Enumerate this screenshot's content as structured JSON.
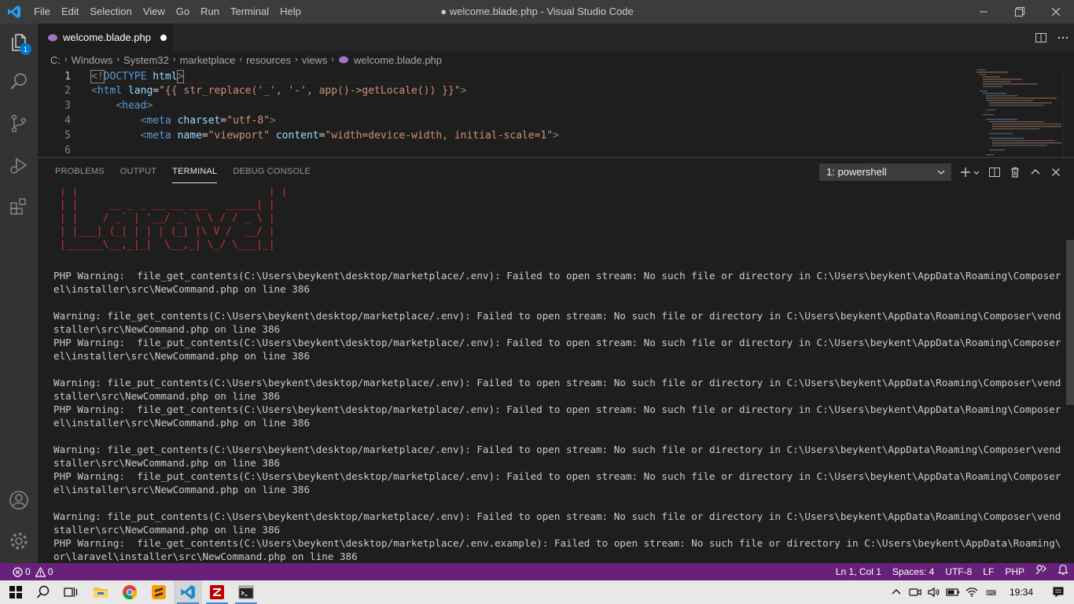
{
  "window": {
    "title": "● welcome.blade.php - Visual Studio Code",
    "menu": [
      "File",
      "Edit",
      "Selection",
      "View",
      "Go",
      "Run",
      "Terminal",
      "Help"
    ]
  },
  "activity_bar": {
    "explorer_badge": "1"
  },
  "editor": {
    "tab_label": "welcome.blade.php",
    "breadcrumb": [
      "C:",
      "Windows",
      "System32",
      "marketplace",
      "resources",
      "views",
      "welcome.blade.php"
    ],
    "lines": [
      {
        "n": "1",
        "tokens": [
          [
            "<!",
            "punct"
          ],
          [
            "DOCTYPE",
            "tag"
          ],
          [
            " html",
            "attr"
          ],
          [
            ">",
            "punct"
          ]
        ]
      },
      {
        "n": "2",
        "tokens": [
          [
            "<",
            "punct"
          ],
          [
            "html",
            "tag"
          ],
          [
            " lang",
            "attr"
          ],
          [
            "=",
            "text"
          ],
          [
            "\"{{ str_replace('_', '-', app()->getLocale()) }}\"",
            "str"
          ],
          [
            ">",
            "punct"
          ]
        ]
      },
      {
        "n": "3",
        "tokens": [
          [
            "    ",
            "text"
          ],
          [
            "<",
            "punct"
          ],
          [
            "head",
            "tag"
          ],
          [
            ">",
            "punct"
          ]
        ]
      },
      {
        "n": "4",
        "tokens": [
          [
            "        ",
            "text"
          ],
          [
            "<",
            "punct"
          ],
          [
            "meta",
            "tag"
          ],
          [
            " charset",
            "attr"
          ],
          [
            "=",
            "text"
          ],
          [
            "\"utf-8\"",
            "str"
          ],
          [
            ">",
            "punct"
          ]
        ]
      },
      {
        "n": "5",
        "tokens": [
          [
            "        ",
            "text"
          ],
          [
            "<",
            "punct"
          ],
          [
            "meta",
            "tag"
          ],
          [
            " name",
            "attr"
          ],
          [
            "=",
            "text"
          ],
          [
            "\"viewport\"",
            "str"
          ],
          [
            " content",
            "attr"
          ],
          [
            "=",
            "text"
          ],
          [
            "\"width=device-width, initial-scale=1\"",
            "str"
          ],
          [
            ">",
            "punct"
          ]
        ]
      },
      {
        "n": "6",
        "tokens": []
      }
    ]
  },
  "panel": {
    "tabs": [
      "PROBLEMS",
      "OUTPUT",
      "TERMINAL",
      "DEBUG CONSOLE"
    ],
    "active_tab": "TERMINAL",
    "terminal_select": "1: powershell",
    "ascii_art": " | |                               | |\n | |     __ _ _ __ __ ___   _____| |\n | |    / _` | '__/ _` \\ \\ / / _ \\ |\n | |___| (_| | | | (_| |\\ V /  __/ |\n |______\\__,_|_|  \\__,_| \\_/ \\___|_|",
    "terminal_lines": [
      "PHP Warning:  file_get_contents(C:\\Users\\beykent\\desktop/marketplace/.env): Failed to open stream: No such file or directory in C:\\Users\\beykent\\AppData\\Roaming\\Composer\\vendor\\larav",
      "el\\installer\\src\\NewCommand.php on line 386",
      "",
      "Warning: file_get_contents(C:\\Users\\beykent\\desktop/marketplace/.env): Failed to open stream: No such file or directory in C:\\Users\\beykent\\AppData\\Roaming\\Composer\\vendor\\laravel\\in",
      "staller\\src\\NewCommand.php on line 386",
      "PHP Warning:  file_put_contents(C:\\Users\\beykent\\desktop/marketplace/.env): Failed to open stream: No such file or directory in C:\\Users\\beykent\\AppData\\Roaming\\Composer\\vendor\\larav",
      "el\\installer\\src\\NewCommand.php on line 386",
      "",
      "Warning: file_put_contents(C:\\Users\\beykent\\desktop/marketplace/.env): Failed to open stream: No such file or directory in C:\\Users\\beykent\\AppData\\Roaming\\Composer\\vendor\\laravel\\in",
      "staller\\src\\NewCommand.php on line 386",
      "PHP Warning:  file_get_contents(C:\\Users\\beykent\\desktop/marketplace/.env): Failed to open stream: No such file or directory in C:\\Users\\beykent\\AppData\\Roaming\\Composer\\vendor\\larav",
      "el\\installer\\src\\NewCommand.php on line 386",
      "",
      "Warning: file_get_contents(C:\\Users\\beykent\\desktop/marketplace/.env): Failed to open stream: No such file or directory in C:\\Users\\beykent\\AppData\\Roaming\\Composer\\vendor\\laravel\\in",
      "staller\\src\\NewCommand.php on line 386",
      "PHP Warning:  file_put_contents(C:\\Users\\beykent\\desktop/marketplace/.env): Failed to open stream: No such file or directory in C:\\Users\\beykent\\AppData\\Roaming\\Composer\\vendor\\larav",
      "el\\installer\\src\\NewCommand.php on line 386",
      "",
      "Warning: file_put_contents(C:\\Users\\beykent\\desktop/marketplace/.env): Failed to open stream: No such file or directory in C:\\Users\\beykent\\AppData\\Roaming\\Composer\\vendor\\laravel\\in",
      "staller\\src\\NewCommand.php on line 386",
      "PHP Warning:  file_get_contents(C:\\Users\\beykent\\desktop/marketplace/.env.example): Failed to open stream: No such file or directory in C:\\Users\\beykent\\AppData\\Roaming\\Composer\\vend",
      "or\\laravel\\installer\\src\\NewCommand.php on line 386"
    ]
  },
  "status_bar": {
    "errors": "0",
    "warnings": "0",
    "position": "Ln 1, Col 1",
    "spaces": "Spaces: 4",
    "encoding": "UTF-8",
    "eol": "LF",
    "language": "PHP"
  },
  "taskbar": {
    "time": "19:34"
  },
  "colors": {
    "status_bar": "#68217a",
    "title_bar": "#3c3c3c",
    "activity_bar": "#333333",
    "editor_bg": "#1e1e1e",
    "ascii_art": "#cd3131"
  }
}
